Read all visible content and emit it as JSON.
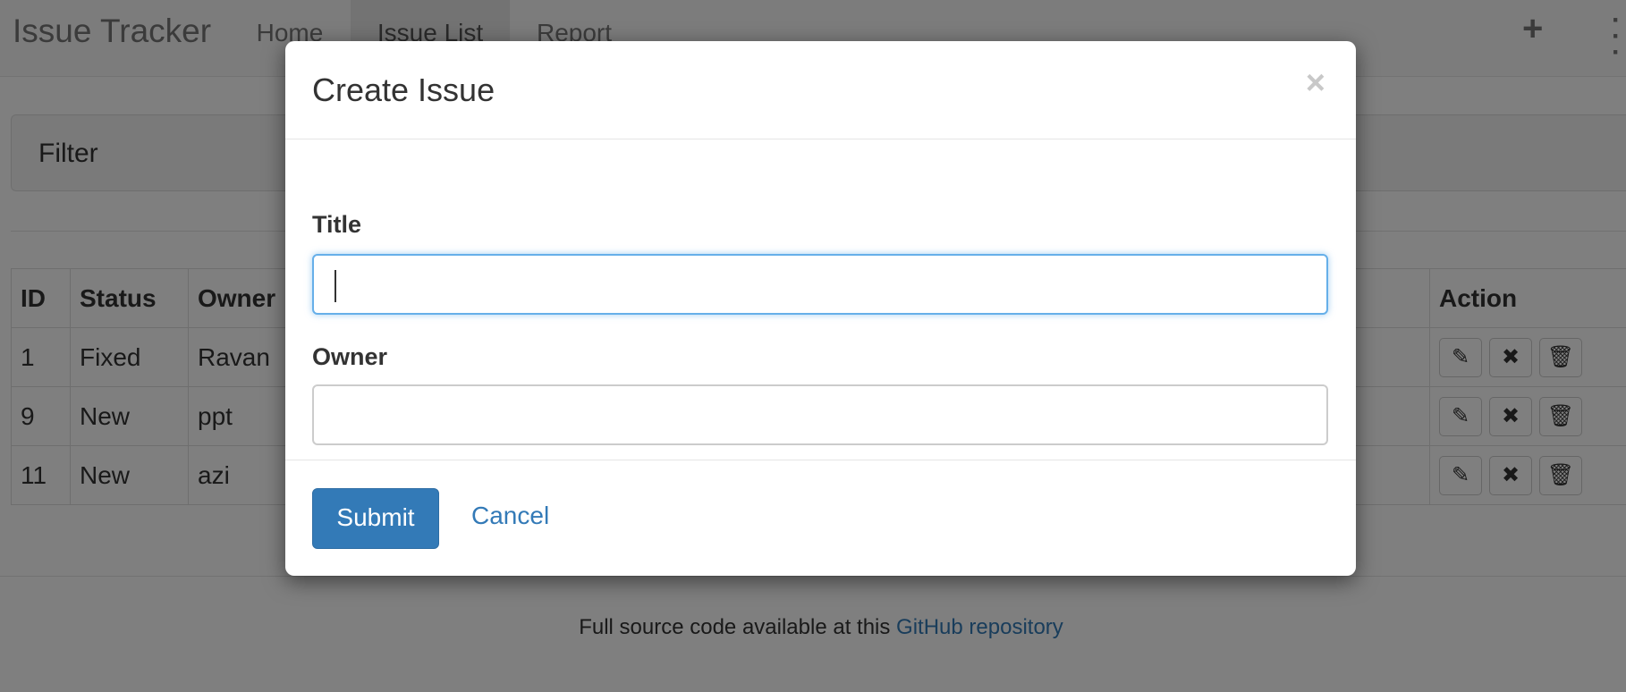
{
  "navbar": {
    "brand": "Issue Tracker",
    "items": [
      {
        "label": "Home",
        "active": false
      },
      {
        "label": "Issue List",
        "active": true
      },
      {
        "label": "Report",
        "active": false
      }
    ],
    "add_icon": "plus-icon",
    "menu_icon": "vertical-dots-icon"
  },
  "filter": {
    "title": "Filter"
  },
  "table": {
    "headers": {
      "id": "ID",
      "status": "Status",
      "owner": "Owner",
      "action": "Action"
    },
    "rows": [
      {
        "id": "1",
        "status": "Fixed",
        "owner": "Ravan"
      },
      {
        "id": "9",
        "status": "New",
        "owner": "ppt"
      },
      {
        "id": "11",
        "status": "New",
        "owner": "azi"
      }
    ],
    "action_icons": [
      "edit-icon",
      "close-icon",
      "trash-icon"
    ]
  },
  "footer": {
    "text": "Full source code available at this",
    "link": "GitHub repository"
  },
  "modal": {
    "title": "Create Issue",
    "close_icon": "close-icon",
    "title_label": "Title",
    "title_value": "",
    "owner_label": "Owner",
    "owner_value": "",
    "submit_label": "Submit",
    "cancel_label": "Cancel"
  },
  "colors": {
    "primary": "#337ab7",
    "focus_border": "#66afe9",
    "backdrop": "rgba(0,0,0,0.5)"
  }
}
